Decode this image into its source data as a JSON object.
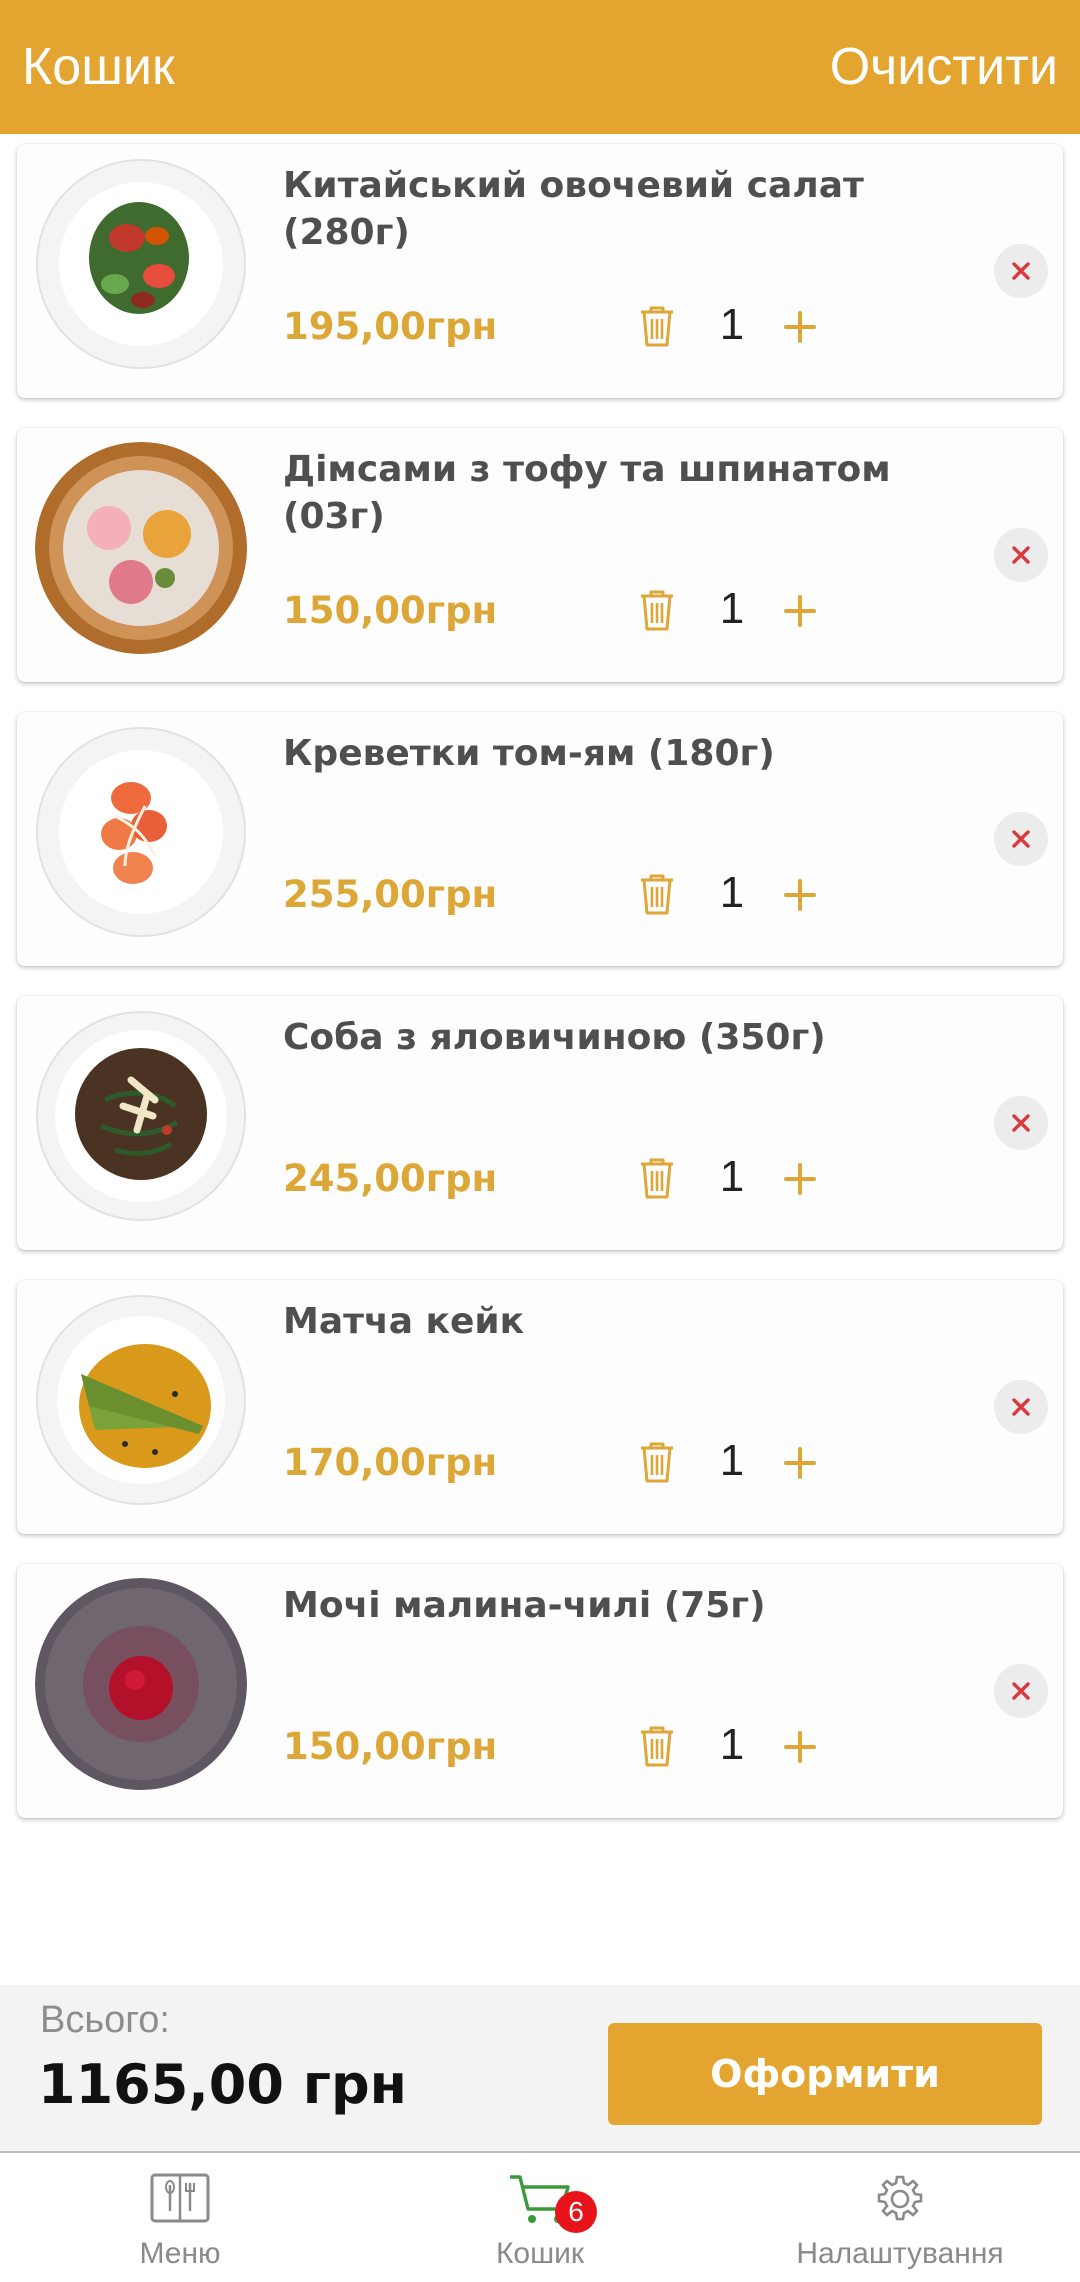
{
  "header": {
    "title": "Кошик",
    "clear_label": "Очистити"
  },
  "cart": {
    "items": [
      {
        "name": "Китайський овочевий салат (280г)",
        "price": "195,00грн",
        "quantity": "1",
        "photo": "salad-dish"
      },
      {
        "name": "Дімсами з тофу та шпинатом (03г)",
        "price": "150,00грн",
        "quantity": "1",
        "photo": "dimsum-dish"
      },
      {
        "name": "Креветки том-ям (180г)",
        "price": "255,00грн",
        "quantity": "1",
        "photo": "shrimp-dish"
      },
      {
        "name": "Соба з яловичиною (350г)",
        "price": "245,00грн",
        "quantity": "1",
        "photo": "soba-dish"
      },
      {
        "name": "Матча кейк",
        "price": "170,00грн",
        "quantity": "1",
        "photo": "matcha-cake-dish"
      },
      {
        "name": "Мочі малина-чилі (75г)",
        "price": "150,00грн",
        "quantity": "1",
        "photo": "mochi-dish"
      }
    ],
    "icons": {
      "decrement": "trash-icon",
      "increment": "plus-icon",
      "remove": "close-icon"
    }
  },
  "total": {
    "label": "Всього:",
    "value": "1165,00 грн",
    "checkout_label": "Оформити"
  },
  "tabs": [
    {
      "label": "Меню",
      "icon": "menu-book-icon"
    },
    {
      "label": "Кошик",
      "icon": "cart-icon",
      "badge": "6",
      "active": true
    },
    {
      "label": "Налаштування",
      "icon": "gear-icon"
    }
  ],
  "colors": {
    "accent": "#e3a52f",
    "price": "#dca737",
    "badge": "#e8141b",
    "remove_x": "#d9393c",
    "active_tab_icon": "#3a9a3a"
  }
}
